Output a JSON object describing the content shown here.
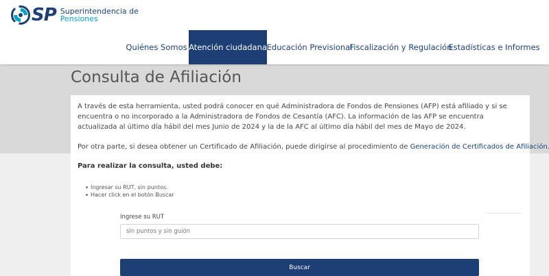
{
  "logo": {
    "icon": "spiral-logo-icon",
    "abbr": "SP",
    "line1": "Superintendencia de",
    "line2": "Pensiones"
  },
  "nav": {
    "items": [
      {
        "label": "Quiénes Somos",
        "active": false
      },
      {
        "label": "Atención ciudadana",
        "active": true
      },
      {
        "label": "Educación Previsional",
        "active": false
      },
      {
        "label": "Fiscalización y Regulación",
        "active": false
      },
      {
        "label": "Estadísticas e Informes",
        "active": false
      }
    ]
  },
  "page": {
    "title": "Consulta de Afiliación",
    "intro": "A través de esta herramienta, usted podrá conocer en qué Administradora de Fondos de Pensiones (AFP) está afiliado y si se encuentra o no incorporado a la Administradora de Fondos de Cesantía (AFC). La información de las AFP se encuentra actualizada al último día hábil del mes Junio de 2024 y la de la AFC al último día hábil del mes de Mayo de 2024.",
    "certificate_text": "Por otra parte, si desea obtener un Certificado de Afiliación, puede dirigirse al procedimiento de ",
    "certificate_link": "Generación de Certificados de Afiliación",
    "certificate_end": ".",
    "instructions_title": "Para realizar la consulta, usted debe:",
    "steps": [
      "Ingresar su RUT, sin puntos.",
      "Hacer click en el botón Buscar"
    ]
  },
  "form": {
    "rut_label": "Ingrese su RUT",
    "rut_value": "",
    "rut_placeholder": "sin puntos y sin guión",
    "search_label": "Buscar"
  },
  "colors": {
    "brand_navy": "#1d3f76",
    "brand_cyan": "#00a3c4",
    "band_gray": "#d9d9d9",
    "page_gray": "#f0f0f0"
  }
}
